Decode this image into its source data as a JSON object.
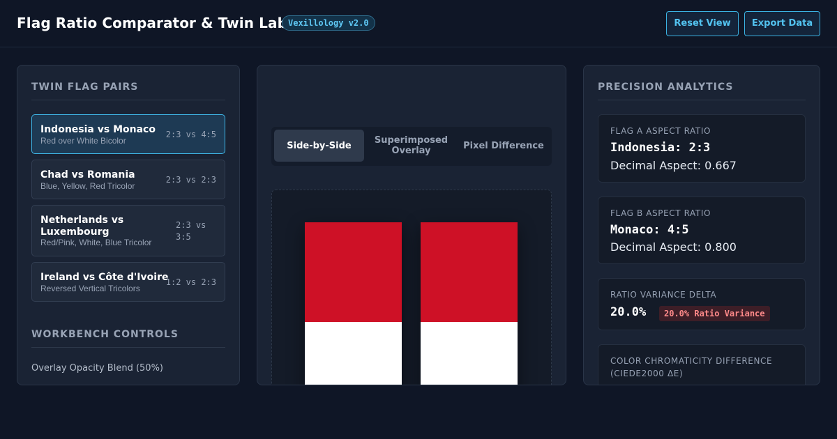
{
  "header": {
    "title": "Flag Ratio Comparator & Twin Lab",
    "badge": "Vexillology v2.0",
    "reset_label": "Reset View",
    "export_label": "Export Data"
  },
  "sidebar": {
    "pairs_title": "TWIN FLAG PAIRS",
    "pairs": [
      {
        "name": "Indonesia vs Monaco",
        "subtitle": "Red over White Bicolor",
        "ratio": "2:3 vs 4:5",
        "active": true
      },
      {
        "name": "Chad vs Romania",
        "subtitle": "Blue, Yellow, Red Tricolor",
        "ratio": "2:3 vs 2:3",
        "active": false
      },
      {
        "name": "Netherlands vs Luxembourg",
        "subtitle": "Red/Pink, White, Blue Tricolor",
        "ratio": "2:3 vs 3:5",
        "active": false
      },
      {
        "name": "Ireland vs Côte d'Ivoire",
        "subtitle": "Reversed Vertical Tricolors",
        "ratio": "1:2 vs 2:3",
        "active": false
      }
    ],
    "controls_title": "WORKBENCH CONTROLS",
    "opacity_label": "Overlay Opacity Blend (50%)"
  },
  "workspace": {
    "tabs": [
      {
        "label": "Side-by-Side",
        "active": true
      },
      {
        "label": "Superimposed Overlay",
        "active": false
      },
      {
        "label": "Pixel Difference",
        "active": false
      }
    ],
    "flag_a": {
      "top_color": "#ce1126",
      "bottom_color": "#ffffff"
    },
    "flag_b": {
      "top_color": "#ce1126",
      "bottom_color": "#ffffff"
    }
  },
  "analytics": {
    "title": "PRECISION ANALYTICS",
    "flag_a": {
      "label": "FLAG A ASPECT RATIO",
      "value": "Indonesia: 2:3",
      "decimal": "Decimal Aspect: 0.667"
    },
    "flag_b": {
      "label": "FLAG B ASPECT RATIO",
      "value": "Monaco: 4:5",
      "decimal": "Decimal Aspect: 0.800"
    },
    "variance": {
      "label": "RATIO VARIANCE DELTA",
      "value": "20.0%",
      "badge": "20.0% Ratio Variance"
    },
    "color": {
      "label": "COLOR CHROMATICITY DIFFERENCE (CIEDE2000 ΔE)"
    }
  },
  "colors": {
    "accent": "#3bb3e3",
    "danger": "#ff8a8a",
    "background": "#0f1626"
  }
}
